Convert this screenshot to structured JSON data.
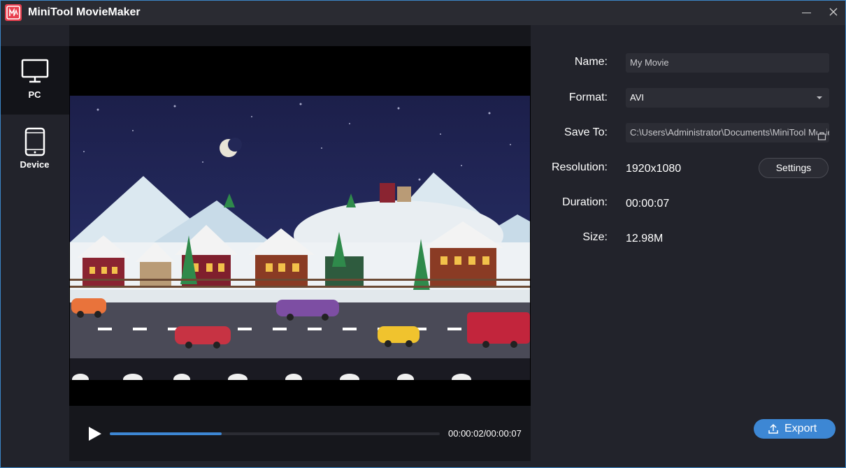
{
  "window": {
    "title": "MiniTool MovieMaker",
    "icons": {
      "logo": "moviemaker-logo-icon",
      "minimize": "minimize-icon",
      "close": "close-icon"
    },
    "border_color": "#3c87c8"
  },
  "sidebar": {
    "items": [
      {
        "label": "PC",
        "icon": "monitor-icon",
        "active": true
      },
      {
        "label": "Device",
        "icon": "smartphone-icon",
        "active": false
      }
    ]
  },
  "player": {
    "progress_fraction": 0.34,
    "time_text": "00:00:02/00:00:07",
    "icons": {
      "play": "play-icon"
    },
    "accent": "#3d87d4"
  },
  "export_settings": {
    "name_label": "Name:",
    "name_value": "My Movie",
    "format_label": "Format:",
    "format_value": "AVI",
    "save_to_label": "Save To:",
    "save_to_value": "C:\\Users\\Administrator\\Documents\\MiniTool MovieMaker",
    "resolution_label": "Resolution:",
    "resolution_value": "1920x1080",
    "settings_button": "Settings",
    "duration_label": "Duration:",
    "duration_value": "00:00:07",
    "size_label": "Size:",
    "size_value": "12.98M",
    "export_button": "Export",
    "icons": {
      "folder": "folder-icon",
      "format_dropdown": "chevron-down-icon",
      "export": "export-icon"
    }
  }
}
